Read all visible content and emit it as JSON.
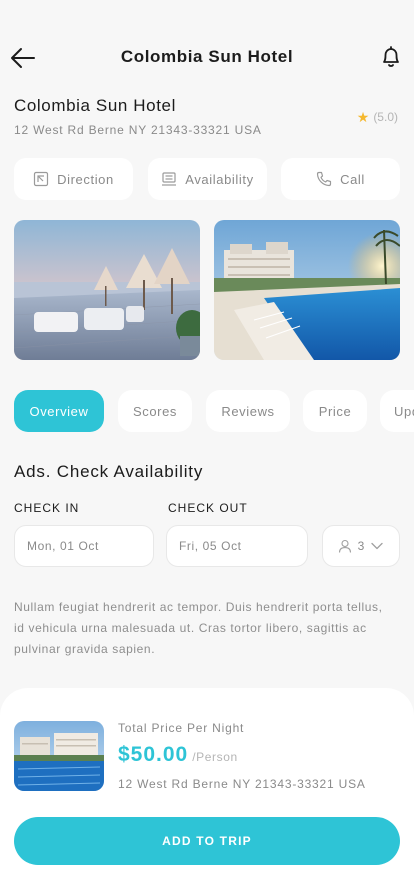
{
  "header": {
    "title": "Colombia Sun Hotel",
    "back_icon": "arrow-left-icon",
    "bell_icon": "bell-icon"
  },
  "hotel": {
    "name": "Colombia Sun Hotel",
    "address": "12 West Rd Berne NY 21343-33321 USA",
    "rating": "(5.0)",
    "star_icon": "star-icon",
    "star_color": "#f5b82e"
  },
  "actions": [
    {
      "label": "Direction",
      "icon": "direction-icon"
    },
    {
      "label": "Availability",
      "icon": "availability-icon"
    },
    {
      "label": "Call",
      "icon": "phone-icon"
    }
  ],
  "photos": [
    {
      "subject": "seaside-terrace-photo"
    },
    {
      "subject": "resort-pool-photo"
    }
  ],
  "tabs": [
    {
      "label": "Overview",
      "active": true
    },
    {
      "label": "Scores",
      "active": false
    },
    {
      "label": "Reviews",
      "active": false
    },
    {
      "label": "Price",
      "active": false
    },
    {
      "label": "Upd",
      "active": false
    }
  ],
  "availability": {
    "title": "Ads. Check Availability",
    "check_in_label": "CHECK IN",
    "check_in_value": "Mon, 01 Oct",
    "check_out_label": "CHECK OUT",
    "check_out_value": "Fri, 05 Oct",
    "guests": "3",
    "guest_icon": "person-icon",
    "chevron_icon": "chevron-down-icon"
  },
  "description": "Nullam feugiat hendrerit ac tempor. Duis hendrerit porta tellus, id vehicula urna malesuada ut. Cras tortor libero, sagittis ac pulvinar gravida sapien.",
  "booking": {
    "price_label": "Total Price Per Night",
    "price": "$50.00",
    "price_unit": "/Person",
    "address": "12 West Rd Berne NY 21343-33321 USA",
    "cta": "ADD TO TRIP"
  },
  "colors": {
    "accent": "#2ec4d6",
    "background": "#f7f7f7",
    "muted_text": "#8a8a8a"
  }
}
